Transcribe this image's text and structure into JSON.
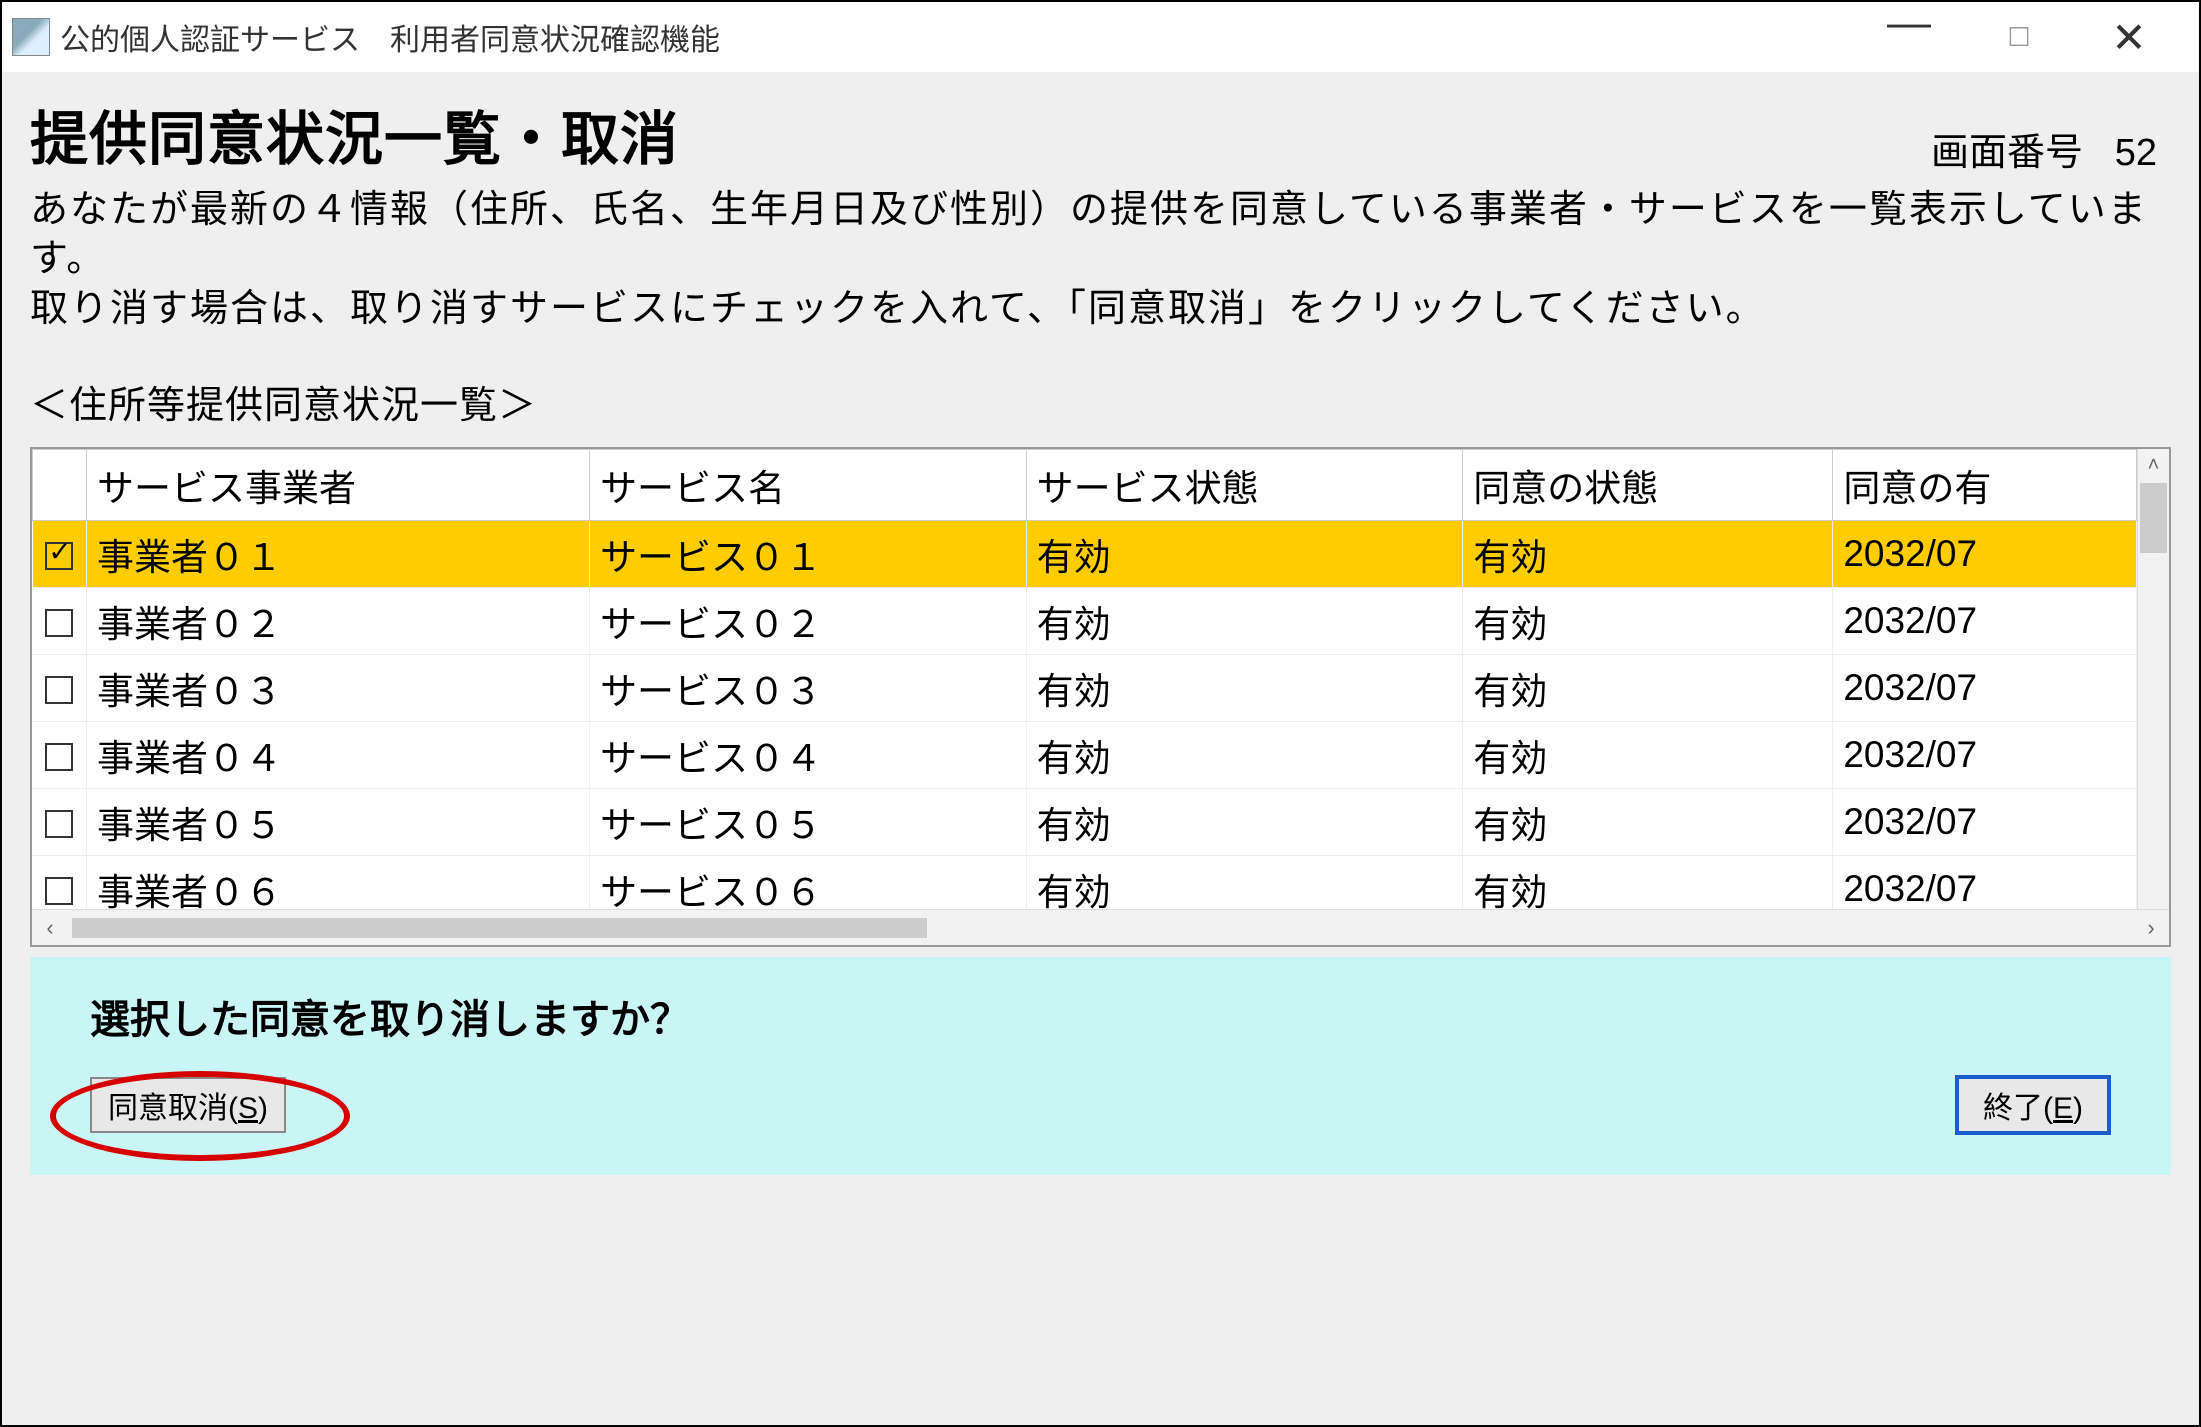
{
  "window": {
    "title": "公的個人認証サービス　利用者同意状況確認機能"
  },
  "header": {
    "page_title": "提供同意状況一覧・取消",
    "screen_number_label": "画面番号",
    "screen_number_value": "52"
  },
  "description": "あなたが最新の４情報（住所、氏名、生年月日及び性別）の提供を同意している事業者・サービスを一覧表示しています。\n取り消す場合は、取り消すサービスにチェックを入れて、「同意取消」をクリックしてください。",
  "list_label": "＜住所等提供同意状況一覧＞",
  "table": {
    "headers": [
      "",
      "サービス事業者",
      "サービス名",
      "サービス状態",
      "同意の状態",
      "同意の有"
    ],
    "rows": [
      {
        "checked": true,
        "provider": "事業者０１",
        "service": "サービス０１",
        "service_status": "有効",
        "consent_status": "有効",
        "consent_date": "2032/07"
      },
      {
        "checked": false,
        "provider": "事業者０２",
        "service": "サービス０２",
        "service_status": "有効",
        "consent_status": "有効",
        "consent_date": "2032/07"
      },
      {
        "checked": false,
        "provider": "事業者０３",
        "service": "サービス０３",
        "service_status": "有効",
        "consent_status": "有効",
        "consent_date": "2032/07"
      },
      {
        "checked": false,
        "provider": "事業者０４",
        "service": "サービス０４",
        "service_status": "有効",
        "consent_status": "有効",
        "consent_date": "2032/07"
      },
      {
        "checked": false,
        "provider": "事業者０５",
        "service": "サービス０５",
        "service_status": "有効",
        "consent_status": "有効",
        "consent_date": "2032/07"
      },
      {
        "checked": false,
        "provider": "事業者０６",
        "service": "サービス０６",
        "service_status": "有効",
        "consent_status": "有効",
        "consent_date": "2032/07"
      }
    ]
  },
  "footer": {
    "question": "選択した同意を取り消しますか？",
    "cancel_button_prefix": "同意取消(",
    "cancel_button_key": "S",
    "cancel_button_suffix": ")",
    "exit_button_prefix": "終了(",
    "exit_button_key": "E",
    "exit_button_suffix": ")"
  }
}
